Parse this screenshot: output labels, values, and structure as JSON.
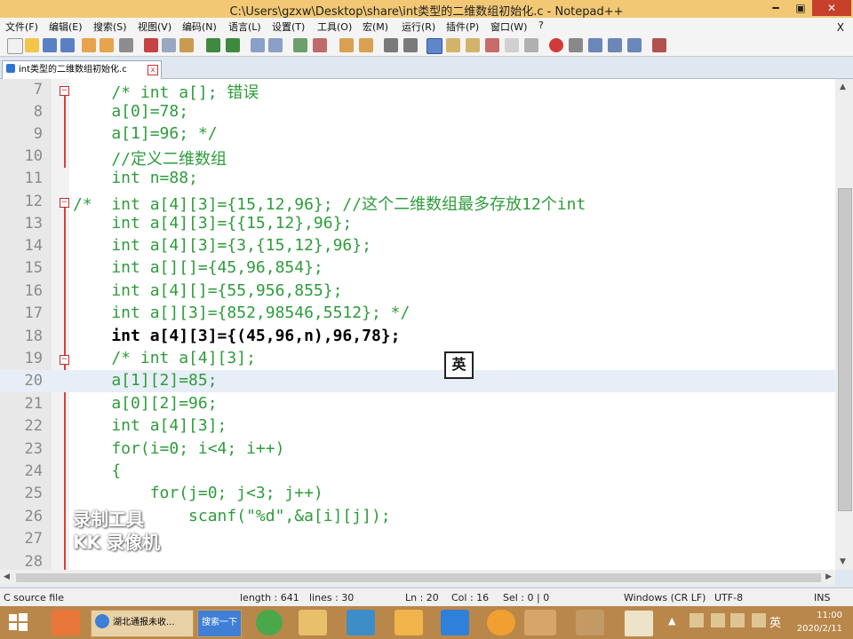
{
  "window": {
    "title": "C:\\Users\\gzxw\\Desktop\\share\\int类型的二维数组初始化.c - Notepad++",
    "minimize_label": "━",
    "maximize_label": "▣",
    "close_label": "✕"
  },
  "menu": {
    "items": [
      "文件(F)",
      "编辑(E)",
      "搜索(S)",
      "视图(V)",
      "编码(N)",
      "语言(L)",
      "设置(T)",
      "工具(O)",
      "宏(M)",
      "运行(R)",
      "插件(P)",
      "窗口(W)",
      "?"
    ],
    "close_label": "X"
  },
  "tab": {
    "label": "int类型的二维数组初始化.c",
    "close_label": "x"
  },
  "editor": {
    "lines": [
      {
        "num": "7",
        "text": "    /* int a[]; 错误"
      },
      {
        "num": "8",
        "text": "    a[0]=78;"
      },
      {
        "num": "9",
        "text": "    a[1]=96; */"
      },
      {
        "num": "10",
        "text": "    //定义二维数组"
      },
      {
        "num": "11",
        "text": "    int n=88;"
      },
      {
        "num": "12",
        "text": "/*  int a[4][3]={15,12,96}; //这个二维数组最多存放12个int"
      },
      {
        "num": "13",
        "text": "    int a[4][3]={{15,12},96};"
      },
      {
        "num": "14",
        "text": "    int a[4][3]={3,{15,12},96};"
      },
      {
        "num": "15",
        "text": "    int a[][]={45,96,854};"
      },
      {
        "num": "16",
        "text": "    int a[4][]={55,956,855};"
      },
      {
        "num": "17",
        "text": "    int a[][3]={852,98546,5512}; */"
      },
      {
        "num": "18",
        "text": "    int a[4][3]={(45,96,n),96,78};"
      },
      {
        "num": "19",
        "text": "    /* int a[4][3];"
      },
      {
        "num": "20",
        "text": "    a[1][2]=85;"
      },
      {
        "num": "21",
        "text": "    a[0][2]=96;"
      },
      {
        "num": "22",
        "text": "    int a[4][3];"
      },
      {
        "num": "23",
        "text": "    for(i=0; i<4; i++)"
      },
      {
        "num": "24",
        "text": "    {"
      },
      {
        "num": "25",
        "text": "        for(j=0; j<3; j++)"
      },
      {
        "num": "26",
        "text": "            scanf(\"%d\",&a[i][j]);"
      },
      {
        "num": "27",
        "text": ""
      },
      {
        "num": "28",
        "text": ""
      }
    ],
    "ime_indicator": "英"
  },
  "watermark": {
    "line1": "录制工具",
    "line2": "KK 录像机"
  },
  "status": {
    "file_type": "C source file",
    "length": "length : 641",
    "lines": "lines : 30",
    "ln": "Ln : 20",
    "col": "Col : 16",
    "sel": "Sel : 0 | 0",
    "eol": "Windows (CR LF)",
    "encoding": "UTF-8",
    "mode": "INS"
  },
  "taskbar": {
    "browser_label": "湖北通报未收...",
    "search_label": "搜索一下",
    "clock_time": "11:00",
    "clock_date": "2020/2/11",
    "ime_label": "英"
  },
  "colors": {
    "keyword": "#2e9c3b",
    "number": "#f39a3c",
    "current_line": "#e8eef8",
    "titlebar": "#f2c874"
  }
}
